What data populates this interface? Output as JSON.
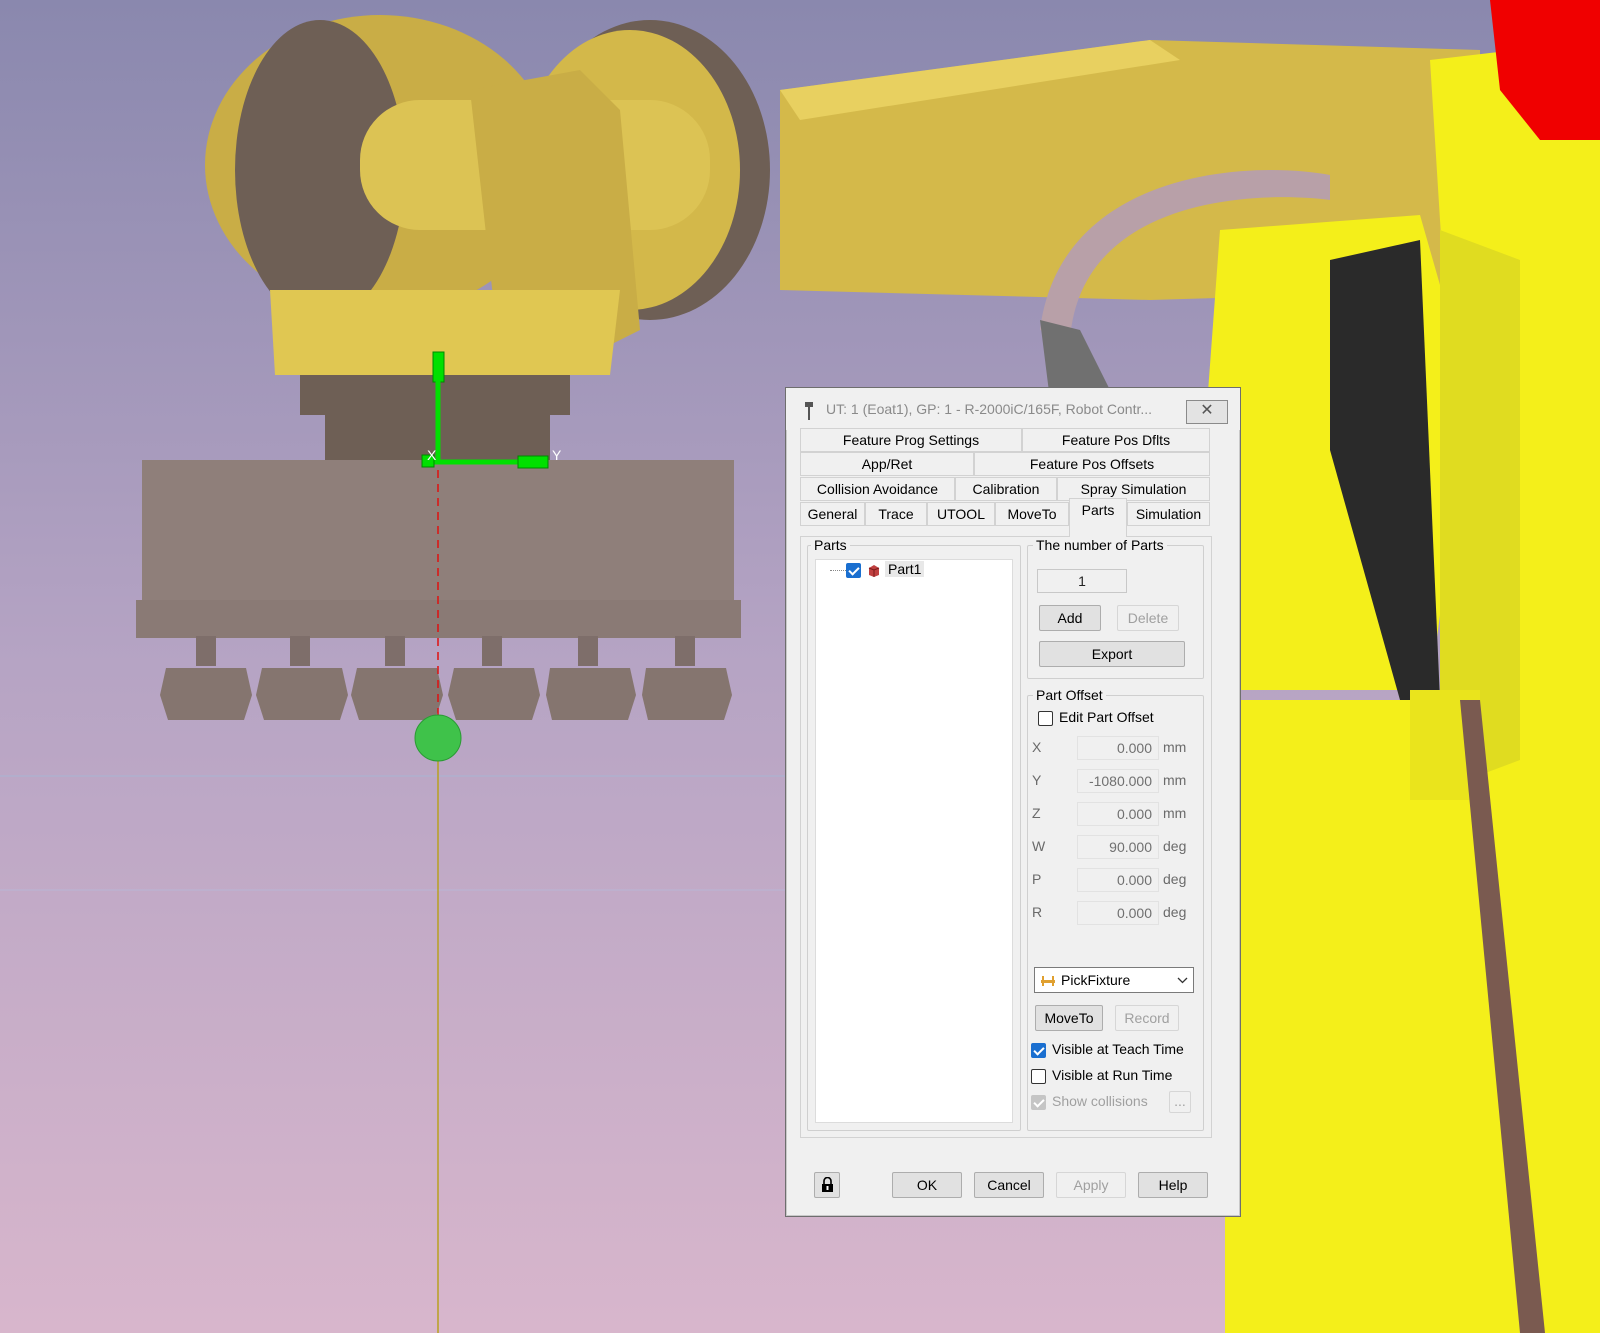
{
  "dialog": {
    "title": "UT: 1  (Eoat1), GP: 1 - R-2000iC/165F, Robot Contr...",
    "close_label": "✕",
    "tabs_row1": [
      "Feature Prog Settings",
      "Feature Pos Dflts"
    ],
    "tabs_row2": [
      "App/Ret",
      "Feature Pos Offsets"
    ],
    "tabs_row3": [
      "Collision Avoidance",
      "Calibration",
      "Spray Simulation"
    ],
    "tabs_row4": [
      "General",
      "Trace",
      "UTOOL",
      "MoveTo",
      "Parts",
      "Simulation"
    ],
    "active_tab": "Parts",
    "parts": {
      "group_label": "Parts",
      "tree_items": [
        {
          "label": "Part1",
          "checked": true
        }
      ]
    },
    "number_of_parts": {
      "group_label": "The number of Parts",
      "value": "1",
      "add_label": "Add",
      "delete_label": "Delete",
      "export_label": "Export"
    },
    "part_offset": {
      "group_label": "Part Offset",
      "edit_label": "Edit Part Offset",
      "edit_checked": false,
      "rows": [
        {
          "axis": "X",
          "value": "0.000",
          "unit": "mm"
        },
        {
          "axis": "Y",
          "value": "-1080.000",
          "unit": "mm"
        },
        {
          "axis": "Z",
          "value": "0.000",
          "unit": "mm"
        },
        {
          "axis": "W",
          "value": "90.000",
          "unit": "deg"
        },
        {
          "axis": "P",
          "value": "0.000",
          "unit": "deg"
        },
        {
          "axis": "R",
          "value": "0.000",
          "unit": "deg"
        }
      ]
    },
    "fixture_select": "PickFixture",
    "moveto_label": "MoveTo",
    "record_label": "Record",
    "visible_teach_label": "Visible at Teach Time",
    "visible_teach_checked": true,
    "visible_run_label": "Visible at Run Time",
    "visible_run_checked": false,
    "show_collisions_label": "Show collisions",
    "ellipsis_label": "...",
    "ok_label": "OK",
    "cancel_label": "Cancel",
    "apply_label": "Apply",
    "help_label": "Help"
  },
  "viewport": {
    "axis_x_label": "X",
    "axis_y_label": "Y",
    "colors": {
      "robot": "#e3c94a",
      "robot_shadow": "#6e5f55",
      "eoat": "#8f7f7a",
      "yellow_base": "#f4ef1a",
      "red": "#f00000",
      "frame": "#00e000"
    }
  }
}
